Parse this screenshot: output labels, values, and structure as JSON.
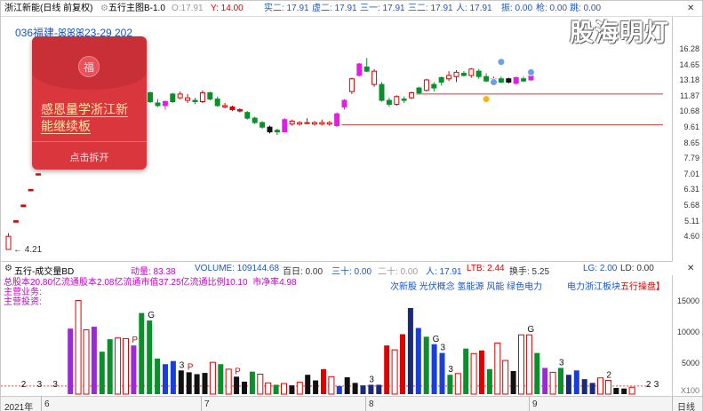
{
  "header": {
    "stock_name": "浙江新能(日线 前复权)",
    "mode_label": "五行主图B-1.0",
    "o_label": "O:17.91",
    "y_label": "Y: 14.00",
    "shi2": "实二: 17.91",
    "xu2": "虚二: 17.91",
    "san1": "三一: 17.91",
    "san2": "三二: 17.91",
    "ren": "人: 17.91",
    "zhen": "振: 0.00",
    "qiang": "枪: 0.00",
    "tiao": "跳: 0.00"
  },
  "main": {
    "code_line": "036福建-ꕤꕤꕤ23-29 202",
    "low_marker": "4.21",
    "price_ticks": [
      "16.28",
      "14.65",
      "13.18",
      "11.87",
      "10.68",
      "9.61",
      "8.65",
      "7.79",
      "7.01",
      "6.31",
      "5.68",
      "5.11",
      "4.60"
    ],
    "price_scale": [
      4.21,
      17.91
    ]
  },
  "envelope": {
    "title_line1": "感恩量学浙江新",
    "title_line2": "能继续板",
    "open_label": "点击拆开",
    "seal": "福"
  },
  "logo": {
    "text": "股海明灯"
  },
  "indicator": {
    "name": "五行-成交量BD",
    "dongliang": "动量: 83.38",
    "volume": "VOLUME: 109144.68",
    "bairi": "百日: 0.00",
    "san10": "三十: 0.00",
    "er10": "二十: 0.00",
    "ren": "人: 17.91",
    "ltb": "LTB: 2.44",
    "huanshou": "换手: 5.25",
    "lg": "LG: 2.00",
    "ld": "LD: 0.00",
    "info_row1": "总股本20.80亿流通股本2.08亿流通市值37.25亿流通比例10.10",
    "info_row1_tail": "市净率4.98",
    "info_row2": "主营业务:",
    "info_row3": "主营投资:",
    "concepts": "次新股 光伏概念 氢能源 风能 绿色电力",
    "concept_right": "电力浙江板块",
    "concept_tag": "五行操盘】",
    "vol_ticks": [
      "15000",
      "10000",
      "5000"
    ],
    "vol_unit": "X100"
  },
  "datebar": {
    "year": "2021年",
    "months": [
      "6",
      "7",
      "8",
      "9"
    ],
    "period": "日线"
  },
  "colors": {
    "up": "#e00000",
    "down": "#0a8f2a",
    "magenta": "#e020e0",
    "black": "#111111",
    "blue": "#1a3fd8",
    "navy": "#1a2a7a",
    "purple": "#9a2ad8"
  },
  "chart_data": {
    "type": "candlestick",
    "ylim": [
      4.21,
      17.91
    ],
    "candles": [
      {
        "o": 4.21,
        "h": 4.7,
        "l": 4.21,
        "c": 4.6,
        "k": "up"
      },
      {
        "o": 5.06,
        "h": 5.11,
        "l": 5.06,
        "c": 5.11,
        "k": "flat"
      },
      {
        "o": 5.62,
        "h": 5.68,
        "l": 5.62,
        "c": 5.68,
        "k": "flat"
      },
      {
        "o": 6.25,
        "h": 6.31,
        "l": 6.25,
        "c": 6.31,
        "k": "flat"
      },
      {
        "o": 6.95,
        "h": 7.01,
        "l": 6.95,
        "c": 7.01,
        "k": "flat"
      },
      {
        "o": 7.72,
        "h": 7.79,
        "l": 7.72,
        "c": 7.79,
        "k": "flat"
      },
      {
        "o": 8.58,
        "h": 8.65,
        "l": 8.58,
        "c": 8.65,
        "k": "flat"
      },
      {
        "o": 9.55,
        "h": 9.61,
        "l": 9.55,
        "c": 9.61,
        "k": "flat"
      },
      {
        "o": 10.6,
        "h": 10.68,
        "l": 10.6,
        "c": 10.68,
        "k": "flat"
      },
      {
        "o": 11.8,
        "h": 11.87,
        "l": 11.8,
        "c": 11.87,
        "k": "flat"
      },
      {
        "o": 13.1,
        "h": 13.18,
        "l": 13.1,
        "c": 13.18,
        "k": "flat"
      },
      {
        "o": 14.55,
        "h": 14.65,
        "l": 14.55,
        "c": 14.65,
        "k": "flat"
      },
      {
        "o": 15.2,
        "h": 16.28,
        "l": 14.9,
        "c": 16.2,
        "k": "mag"
      },
      {
        "o": 16.28,
        "h": 16.5,
        "l": 14.0,
        "c": 14.3,
        "k": "down"
      },
      {
        "o": 14.2,
        "h": 14.4,
        "l": 13.1,
        "c": 13.3,
        "k": "down"
      },
      {
        "o": 13.3,
        "h": 13.6,
        "l": 12.9,
        "c": 13.4,
        "k": "up"
      },
      {
        "o": 13.3,
        "h": 13.5,
        "l": 13.0,
        "c": 13.2,
        "k": "up"
      },
      {
        "o": 13.1,
        "h": 13.3,
        "l": 12.4,
        "c": 12.6,
        "k": "mag"
      },
      {
        "o": 12.6,
        "h": 12.9,
        "l": 12.2,
        "c": 12.3,
        "k": "down"
      },
      {
        "o": 12.1,
        "h": 12.2,
        "l": 11.3,
        "c": 11.4,
        "k": "down"
      },
      {
        "o": 11.3,
        "h": 11.6,
        "l": 11.0,
        "c": 11.1,
        "k": "down"
      },
      {
        "o": 11.1,
        "h": 11.5,
        "l": 10.8,
        "c": 11.4,
        "k": "mag"
      },
      {
        "o": 11.4,
        "h": 12.1,
        "l": 11.3,
        "c": 12.0,
        "k": "down"
      },
      {
        "o": 12.0,
        "h": 12.2,
        "l": 11.6,
        "c": 11.7,
        "k": "up"
      },
      {
        "o": 11.7,
        "h": 12.0,
        "l": 11.3,
        "c": 11.5,
        "k": "up"
      },
      {
        "o": 11.5,
        "h": 11.7,
        "l": 11.2,
        "c": 11.4,
        "k": "down"
      },
      {
        "o": 11.4,
        "h": 12.3,
        "l": 11.3,
        "c": 12.1,
        "k": "up"
      },
      {
        "o": 12.1,
        "h": 12.2,
        "l": 11.5,
        "c": 11.6,
        "k": "down"
      },
      {
        "o": 11.6,
        "h": 11.8,
        "l": 11.0,
        "c": 11.1,
        "k": "down"
      },
      {
        "o": 11.1,
        "h": 11.3,
        "l": 10.9,
        "c": 11.0,
        "k": "up"
      },
      {
        "o": 11.0,
        "h": 11.1,
        "l": 10.7,
        "c": 10.8,
        "k": "flat"
      },
      {
        "o": 10.8,
        "h": 10.9,
        "l": 10.6,
        "c": 10.7,
        "k": "flat"
      },
      {
        "o": 10.6,
        "h": 10.7,
        "l": 10.1,
        "c": 10.2,
        "k": "down"
      },
      {
        "o": 10.2,
        "h": 10.3,
        "l": 9.8,
        "c": 9.9,
        "k": "down"
      },
      {
        "o": 9.9,
        "h": 10.0,
        "l": 9.5,
        "c": 9.6,
        "k": "down"
      },
      {
        "o": 9.6,
        "h": 9.7,
        "l": 9.2,
        "c": 9.3,
        "k": "black"
      },
      {
        "o": 9.3,
        "h": 9.5,
        "l": 9.1,
        "c": 9.4,
        "k": "down"
      },
      {
        "o": 9.3,
        "h": 10.2,
        "l": 9.3,
        "c": 10.1,
        "k": "mag"
      },
      {
        "o": 10.0,
        "h": 10.1,
        "l": 9.7,
        "c": 9.8,
        "k": "up"
      },
      {
        "o": 9.8,
        "h": 10.0,
        "l": 9.7,
        "c": 9.9,
        "k": "up"
      },
      {
        "o": 9.9,
        "h": 10.2,
        "l": 9.8,
        "c": 9.9,
        "k": "up"
      },
      {
        "o": 9.9,
        "h": 10.0,
        "l": 9.7,
        "c": 9.8,
        "k": "up"
      },
      {
        "o": 9.8,
        "h": 10.1,
        "l": 9.7,
        "c": 9.9,
        "k": "up"
      },
      {
        "o": 9.9,
        "h": 10.0,
        "l": 9.7,
        "c": 9.8,
        "k": "up"
      },
      {
        "o": 9.7,
        "h": 10.6,
        "l": 9.6,
        "c": 10.5,
        "k": "mag"
      },
      {
        "o": 11.0,
        "h": 11.6,
        "l": 10.8,
        "c": 11.5,
        "k": "mag"
      },
      {
        "o": 12.2,
        "h": 13.4,
        "l": 12.0,
        "c": 13.3,
        "k": "up"
      },
      {
        "o": 13.6,
        "h": 14.8,
        "l": 13.5,
        "c": 14.7,
        "k": "mag"
      },
      {
        "o": 14.4,
        "h": 15.3,
        "l": 13.9,
        "c": 14.0,
        "k": "down"
      },
      {
        "o": 14.0,
        "h": 14.2,
        "l": 12.6,
        "c": 12.8,
        "k": "up"
      },
      {
        "o": 12.8,
        "h": 13.0,
        "l": 11.4,
        "c": 11.5,
        "k": "down"
      },
      {
        "o": 11.5,
        "h": 11.7,
        "l": 11.0,
        "c": 11.2,
        "k": "down"
      },
      {
        "o": 11.2,
        "h": 11.9,
        "l": 11.1,
        "c": 11.8,
        "k": "up"
      },
      {
        "o": 11.5,
        "h": 11.8,
        "l": 11.3,
        "c": 11.6,
        "k": "down"
      },
      {
        "o": 11.7,
        "h": 12.2,
        "l": 11.6,
        "c": 12.1,
        "k": "up"
      },
      {
        "o": 12.1,
        "h": 12.6,
        "l": 12.0,
        "c": 12.5,
        "k": "down"
      },
      {
        "o": 12.3,
        "h": 13.3,
        "l": 12.2,
        "c": 13.2,
        "k": "up"
      },
      {
        "o": 12.5,
        "h": 13.0,
        "l": 12.2,
        "c": 12.8,
        "k": "down"
      },
      {
        "o": 13.0,
        "h": 13.5,
        "l": 12.7,
        "c": 13.4,
        "k": "down"
      },
      {
        "o": 13.6,
        "h": 14.0,
        "l": 13.1,
        "c": 13.3,
        "k": "up"
      },
      {
        "o": 13.5,
        "h": 14.1,
        "l": 13.0,
        "c": 13.9,
        "k": "up"
      },
      {
        "o": 13.8,
        "h": 14.0,
        "l": 13.5,
        "c": 13.6,
        "k": "down"
      },
      {
        "o": 13.6,
        "h": 14.3,
        "l": 13.4,
        "c": 14.2,
        "k": "up"
      },
      {
        "o": 14.0,
        "h": 14.2,
        "l": 13.3,
        "c": 13.5,
        "k": "down"
      },
      {
        "o": 13.5,
        "h": 13.8,
        "l": 13.0,
        "c": 13.1,
        "k": "down"
      },
      {
        "o": 13.1,
        "h": 13.5,
        "l": 12.9,
        "c": 13.3,
        "k": "up"
      },
      {
        "o": 13.3,
        "h": 13.5,
        "l": 12.9,
        "c": 13.0,
        "k": "down"
      },
      {
        "o": 13.0,
        "h": 13.4,
        "l": 12.9,
        "c": 13.3,
        "k": "black"
      },
      {
        "o": 12.9,
        "h": 13.5,
        "l": 12.8,
        "c": 13.4,
        "k": "mag"
      },
      {
        "o": 13.3,
        "h": 13.5,
        "l": 13.0,
        "c": 13.1,
        "k": "down"
      },
      {
        "o": 13.2,
        "h": 14.2,
        "l": 13.1,
        "c": 14.0,
        "k": "mag"
      }
    ],
    "levels": [
      {
        "price": 12.0,
        "from_index": 55
      },
      {
        "price": 9.75,
        "from_index": 45
      }
    ],
    "volume": [
      {
        "v": 200,
        "k": "dash"
      },
      {
        "v": 220,
        "k": "dash"
      },
      {
        "v": 180,
        "k": "dash"
      },
      {
        "v": 210,
        "k": "dash"
      },
      {
        "v": 190,
        "k": "dash"
      },
      {
        "v": 200,
        "k": "dash"
      },
      {
        "v": 230,
        "k": "dash"
      },
      {
        "v": 250,
        "k": "dash"
      },
      {
        "v": 10500,
        "k": "purple"
      },
      {
        "v": 15000,
        "k": "hollow"
      },
      {
        "v": 10300,
        "k": "hollow"
      },
      {
        "v": 10800,
        "k": "purple"
      },
      {
        "v": 6800,
        "k": "green"
      },
      {
        "v": 8800,
        "k": "green"
      },
      {
        "v": 9000,
        "k": "hollow"
      },
      {
        "v": 8900,
        "k": "hollow"
      },
      {
        "v": 7800,
        "k": "purple"
      },
      {
        "v": 13000,
        "k": "green"
      },
      {
        "v": 11800,
        "k": "green"
      },
      {
        "v": 5700,
        "k": "green"
      },
      {
        "v": 4800,
        "k": "blue"
      },
      {
        "v": 5300,
        "k": "blue"
      },
      {
        "v": 3800,
        "k": "black"
      },
      {
        "v": 3500,
        "k": "black"
      },
      {
        "v": 3200,
        "k": "black"
      },
      {
        "v": 3400,
        "k": "black"
      },
      {
        "v": 5100,
        "k": "hollow"
      },
      {
        "v": 4800,
        "k": "green"
      },
      {
        "v": 4000,
        "k": "hollow"
      },
      {
        "v": 2800,
        "k": "black"
      },
      {
        "v": 2000,
        "k": "black"
      },
      {
        "v": 3600,
        "k": "green"
      },
      {
        "v": 3200,
        "k": "hollow"
      },
      {
        "v": 1800,
        "k": "hollow"
      },
      {
        "v": 1500,
        "k": "green"
      },
      {
        "v": 1700,
        "k": "hollow"
      },
      {
        "v": 1400,
        "k": "black"
      },
      {
        "v": 1900,
        "k": "hollow"
      },
      {
        "v": 3100,
        "k": "black"
      },
      {
        "v": 2200,
        "k": "black"
      },
      {
        "v": 4000,
        "k": "red"
      },
      {
        "v": 2800,
        "k": "hollow"
      },
      {
        "v": 1300,
        "k": "blue"
      },
      {
        "v": 2700,
        "k": "black"
      },
      {
        "v": 1800,
        "k": "black"
      },
      {
        "v": 1400,
        "k": "navy"
      },
      {
        "v": 1500,
        "k": "navy"
      },
      {
        "v": 1500,
        "k": "navy"
      },
      {
        "v": 7800,
        "k": "red"
      },
      {
        "v": 7100,
        "k": "hollow"
      },
      {
        "v": 9600,
        "k": "red"
      },
      {
        "v": 13800,
        "k": "navy"
      },
      {
        "v": 10600,
        "k": "blue"
      },
      {
        "v": 9200,
        "k": "green"
      },
      {
        "v": 8000,
        "k": "blue"
      },
      {
        "v": 6600,
        "k": "blue"
      },
      {
        "v": 3100,
        "k": "green"
      },
      {
        "v": 3300,
        "k": "hollow"
      },
      {
        "v": 7300,
        "k": "green"
      },
      {
        "v": 6500,
        "k": "hollow"
      },
      {
        "v": 7000,
        "k": "red"
      },
      {
        "v": 4000,
        "k": "green"
      },
      {
        "v": 8200,
        "k": "hollow"
      },
      {
        "v": 5400,
        "k": "hollow"
      },
      {
        "v": 3700,
        "k": "black"
      },
      {
        "v": 9500,
        "k": "hollow"
      },
      {
        "v": 9500,
        "k": "hollow"
      },
      {
        "v": 6600,
        "k": "green"
      },
      {
        "v": 4200,
        "k": "purple"
      },
      {
        "v": 3500,
        "k": "hollow"
      },
      {
        "v": 4200,
        "k": "green"
      },
      {
        "v": 3100,
        "k": "navy"
      },
      {
        "v": 3800,
        "k": "blue"
      },
      {
        "v": 2400,
        "k": "navy"
      },
      {
        "v": 1800,
        "k": "navy"
      },
      {
        "v": 2600,
        "k": "hollow"
      },
      {
        "v": 2200,
        "k": "hollow"
      },
      {
        "v": 1000,
        "k": "black"
      },
      {
        "v": 900,
        "k": "black"
      },
      {
        "v": 1100,
        "k": "hollow"
      }
    ],
    "vol_ylim": [
      0,
      16500
    ],
    "vol_markers": [
      {
        "text": "2",
        "index": 2
      },
      {
        "text": "3",
        "index": 4
      },
      {
        "text": "3",
        "index": 6
      },
      {
        "text": "G",
        "index": 18
      },
      {
        "text": "P",
        "index": 16
      },
      {
        "text": "3",
        "index": 22
      },
      {
        "text": "P",
        "index": 23
      },
      {
        "text": "P",
        "index": 29
      },
      {
        "text": "3",
        "index": 46
      },
      {
        "text": "G",
        "index": 54
      },
      {
        "text": "3",
        "index": 55
      },
      {
        "text": "3",
        "index": 56
      },
      {
        "text": "G",
        "index": 66
      },
      {
        "text": "3",
        "index": 70
      },
      {
        "text": "2",
        "index": 76
      },
      {
        "text": "2",
        "index": 81
      },
      {
        "text": "3",
        "index": 82
      }
    ]
  }
}
